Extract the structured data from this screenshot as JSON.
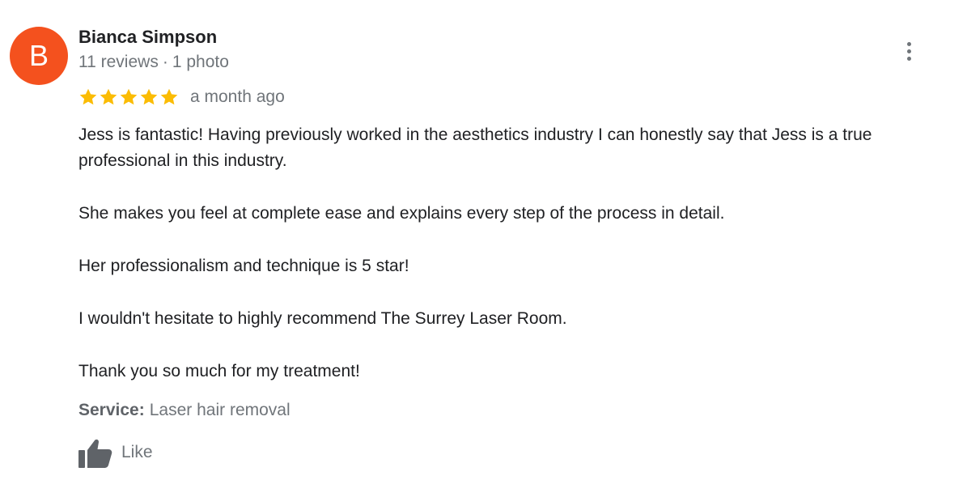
{
  "reviewer": {
    "initial": "B",
    "avatar_color": "#f4511e",
    "name": "Bianca Simpson",
    "reviews_count": "11 reviews",
    "separator": "·",
    "photos_count": "1 photo"
  },
  "review": {
    "rating": 5,
    "rating_max": 5,
    "star_color": "#fbbc04",
    "date": "a month ago",
    "paragraphs": [
      "Jess is fantastic! Having previously worked in the aesthetics industry I can honestly say that Jess is a true professional in this industry.",
      "She makes you feel at complete ease and explains every step of the process in detail.",
      "Her professionalism and technique is 5 star!",
      "I wouldn't hesitate to highly recommend The Surrey Laser Room.",
      "Thank you so much for my treatment!"
    ],
    "service_label": "Service:",
    "service_value": "Laser hair removal"
  },
  "actions": {
    "like_label": "Like",
    "like_icon": "thumbs-up-icon",
    "more_icon": "more-vert-icon"
  }
}
